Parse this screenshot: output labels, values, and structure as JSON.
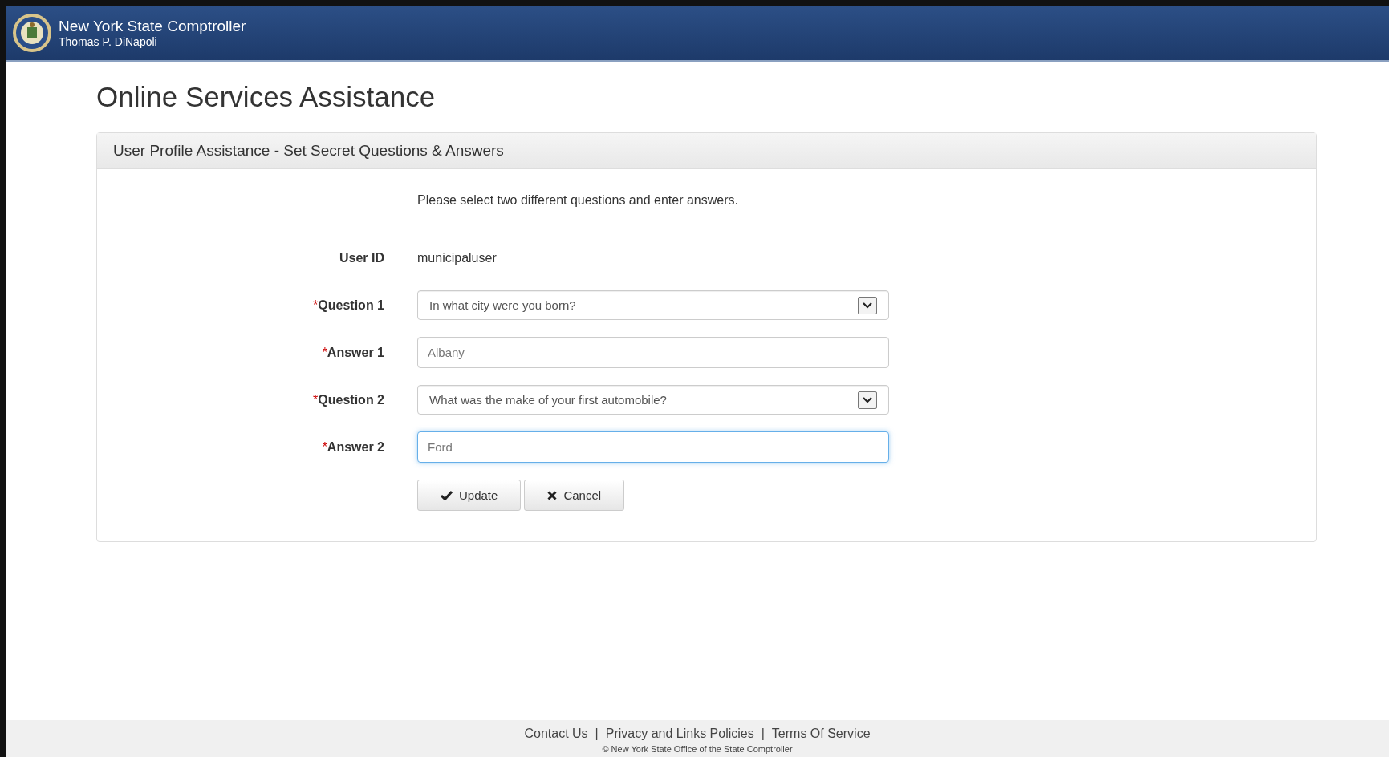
{
  "header": {
    "title": "New York State Comptroller",
    "subtitle": "Thomas P. DiNapoli"
  },
  "page_title": "Online Services Assistance",
  "panel": {
    "title": "User Profile Assistance - Set Secret Questions & Answers",
    "intro": "Please select two different questions and enter answers.",
    "required_mark": "*",
    "fields": [
      {
        "kind": "static",
        "label": "User ID",
        "required": false,
        "value": "municipaluser"
      },
      {
        "kind": "select",
        "label": "Question 1",
        "required": true,
        "value": "In what city were you born?",
        "focused": false
      },
      {
        "kind": "text",
        "label": "Answer 1",
        "required": true,
        "value": "Albany",
        "focused": false
      },
      {
        "kind": "select",
        "label": "Question 2",
        "required": true,
        "value": "What was the make of your first automobile?",
        "focused": false
      },
      {
        "kind": "text",
        "label": "Answer 2",
        "required": true,
        "value": "Ford",
        "focused": true
      }
    ],
    "buttons": [
      {
        "kind": "update",
        "label": "Update"
      },
      {
        "kind": "cancel",
        "label": "Cancel"
      }
    ]
  },
  "footer": {
    "links": [
      "Contact Us",
      "Privacy and Links Policies",
      "Terms Of Service"
    ],
    "separator": "|",
    "copyright": "© New York State Office of the State Comptroller"
  }
}
